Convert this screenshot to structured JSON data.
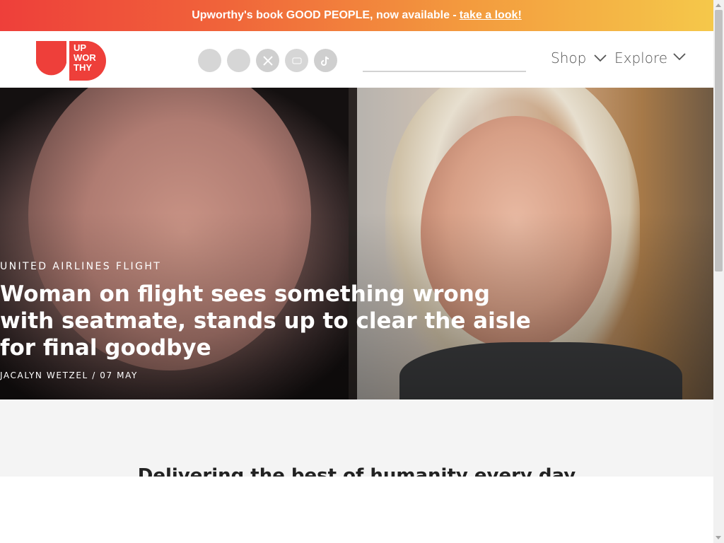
{
  "promo": {
    "text": "Upworthy's book GOOD PEOPLE, now available - ",
    "link": "take a look!"
  },
  "header": {
    "logo_text": [
      "UP",
      "WOR",
      "THY"
    ],
    "social_icons": [
      "facebook-icon",
      "instagram-icon",
      "x-icon",
      "youtube-icon",
      "tiktok-icon"
    ],
    "search_placeholder": "",
    "nav": {
      "shop": "Shop",
      "explore": "Explore"
    }
  },
  "hero": {
    "kicker": "UNITED AIRLINES FLIGHT",
    "headline": "Woman on flight sees something wrong with seatmate, stands up to clear the aisle for final goodbye",
    "author": "JACALYN WETZEL",
    "date": " / 07 MAY"
  },
  "section": {
    "tagline": "Delivering the best of humanity every day"
  },
  "colors": {
    "brand_red": "#ee3f3a",
    "banner_gradient_start": "#ee3f3a",
    "banner_gradient_end": "#f5c84a"
  }
}
